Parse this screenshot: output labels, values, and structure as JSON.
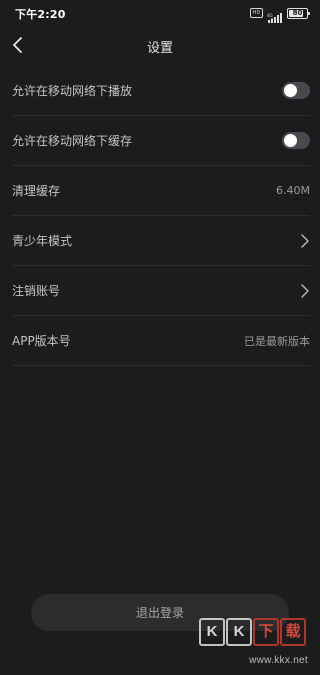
{
  "status_bar": {
    "time": "下午2:20",
    "hd_label": "HD",
    "network_label": "4G",
    "battery_text": "80",
    "battery_level": 0.8
  },
  "nav": {
    "title": "设置",
    "back_icon": "chevron-left-icon"
  },
  "settings": {
    "rows": [
      {
        "label": "允许在移动网络下播放",
        "control": "toggle",
        "on": false
      },
      {
        "label": "允许在移动网络下缓存",
        "control": "toggle",
        "on": false
      },
      {
        "label": "清理缓存",
        "control": "value",
        "value": "6.40M"
      },
      {
        "label": "青少年模式",
        "control": "chevron"
      },
      {
        "label": "注销账号",
        "control": "chevron"
      },
      {
        "label": "APP版本号",
        "control": "value",
        "value": "已是最新版本"
      }
    ]
  },
  "logout": {
    "label": "退出登录"
  },
  "watermark": {
    "logo_chars": [
      "K",
      "K",
      "下",
      "载"
    ],
    "url": "www.kkx.net"
  },
  "colors": {
    "background": "#1c1c1e",
    "divider": "#2c2c2e",
    "toggle_off": "#4a4a4e",
    "button_bg": "#2c2c2e"
  }
}
